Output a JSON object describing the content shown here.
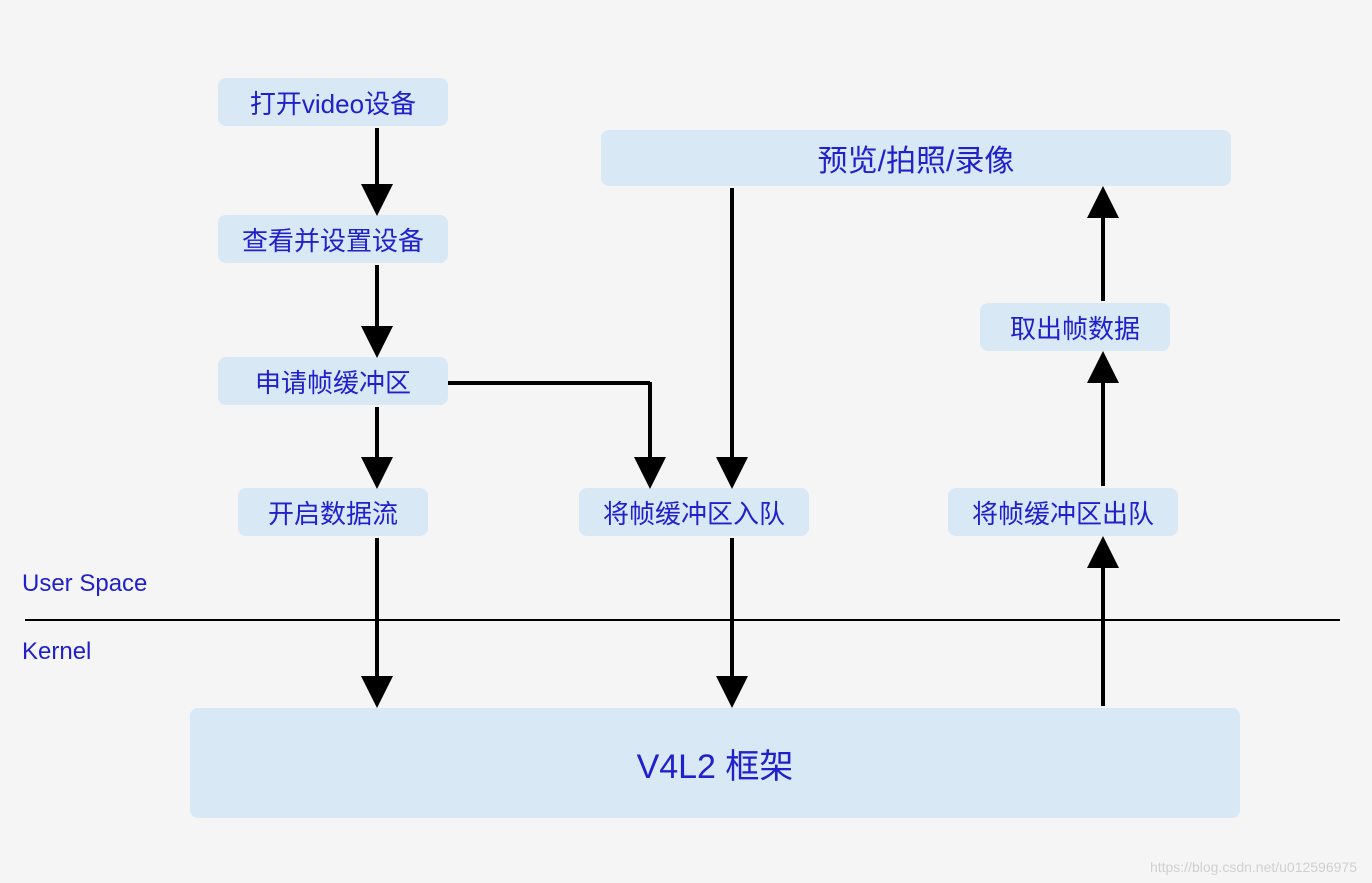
{
  "nodes": {
    "open_video": "打开video设备",
    "check_set": "查看并设置设备",
    "req_buffer": "申请帧缓冲区",
    "start_stream": "开启数据流",
    "preview": "预览/拍照/录像",
    "get_frame": "取出帧数据",
    "enqueue": "将帧缓冲区入队",
    "dequeue": "将帧缓冲区出队",
    "v4l2": "V4L2 框架"
  },
  "labels": {
    "user_space": "User Space",
    "kernel": "Kernel"
  },
  "watermark": "https://blog.csdn.net/u012596975"
}
